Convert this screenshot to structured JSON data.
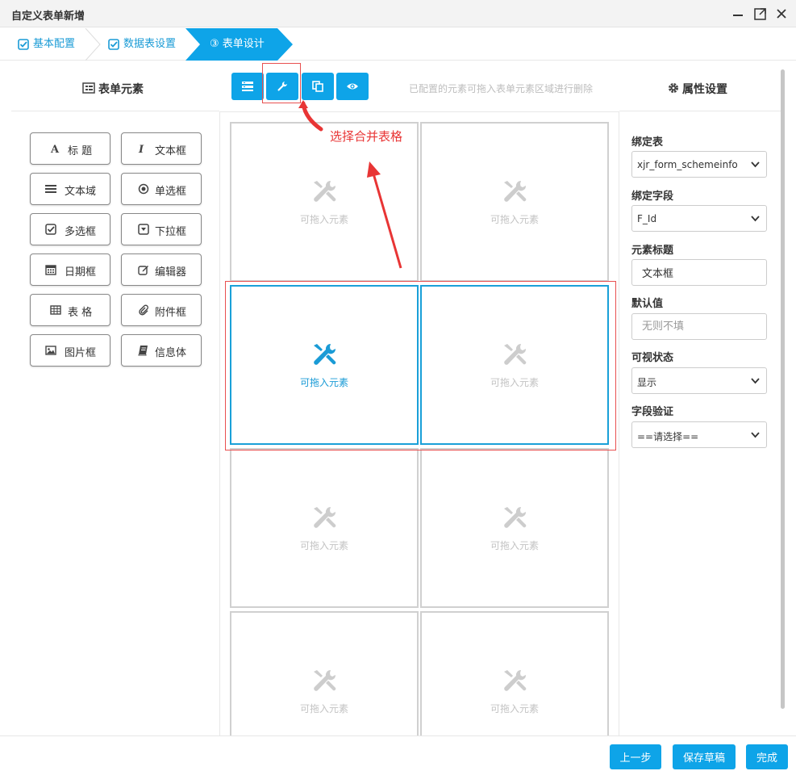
{
  "window": {
    "title": "自定义表单新增",
    "controls": [
      "minimize-icon",
      "maximize-icon",
      "close-icon"
    ]
  },
  "steps": [
    {
      "label": "基本配置",
      "state": "done"
    },
    {
      "label": "数据表设置",
      "state": "done"
    },
    {
      "label": "表单设计",
      "number": "③",
      "state": "active"
    }
  ],
  "left_panel": {
    "title": "表单元素",
    "elements": [
      {
        "label": "标 题",
        "icon": "font-icon"
      },
      {
        "label": "文本框",
        "icon": "italic-icon"
      },
      {
        "label": "文本域",
        "icon": "lines-icon"
      },
      {
        "label": "单选框",
        "icon": "radio-icon"
      },
      {
        "label": "多选框",
        "icon": "checkbox-icon"
      },
      {
        "label": "下拉框",
        "icon": "dropdown-icon"
      },
      {
        "label": "日期框",
        "icon": "calendar-icon"
      },
      {
        "label": "编辑器",
        "icon": "edit-icon"
      },
      {
        "label": "表 格",
        "icon": "table-icon"
      },
      {
        "label": "附件框",
        "icon": "paperclip-icon"
      },
      {
        "label": "图片框",
        "icon": "image-icon"
      },
      {
        "label": "信息体",
        "icon": "book-icon"
      }
    ]
  },
  "toolbar": {
    "buttons": [
      "layout-icon",
      "wrench-icon",
      "copy-icon",
      "eye-icon"
    ],
    "hint": "已配置的元素可拖入表单元素区域进行删除"
  },
  "canvas": {
    "cell_text": "可拖入元素",
    "annotation": "选择合并表格",
    "cells": [
      {
        "state": "normal"
      },
      {
        "state": "normal"
      },
      {
        "state": "active"
      },
      {
        "state": "selected"
      },
      {
        "state": "normal"
      },
      {
        "state": "normal"
      },
      {
        "state": "normal"
      },
      {
        "state": "normal"
      }
    ]
  },
  "right_panel": {
    "title": "属性设置",
    "fields": {
      "bind_table": {
        "label": "绑定表",
        "value": "xjr_form_schemeinfo"
      },
      "bind_field": {
        "label": "绑定字段",
        "value": "F_Id"
      },
      "element_title": {
        "label": "元素标题",
        "value": "文本框"
      },
      "default_value": {
        "label": "默认值",
        "placeholder": "无则不填"
      },
      "visible_state": {
        "label": "可视状态",
        "value": "显示"
      },
      "field_validation": {
        "label": "字段验证",
        "value": "==请选择=="
      }
    }
  },
  "footer": {
    "prev": "上一步",
    "save_draft": "保存草稿",
    "finish": "完成"
  },
  "colors": {
    "accent": "#0ea4e8",
    "annotation": "#e83535",
    "border": "#d0d0d0"
  }
}
